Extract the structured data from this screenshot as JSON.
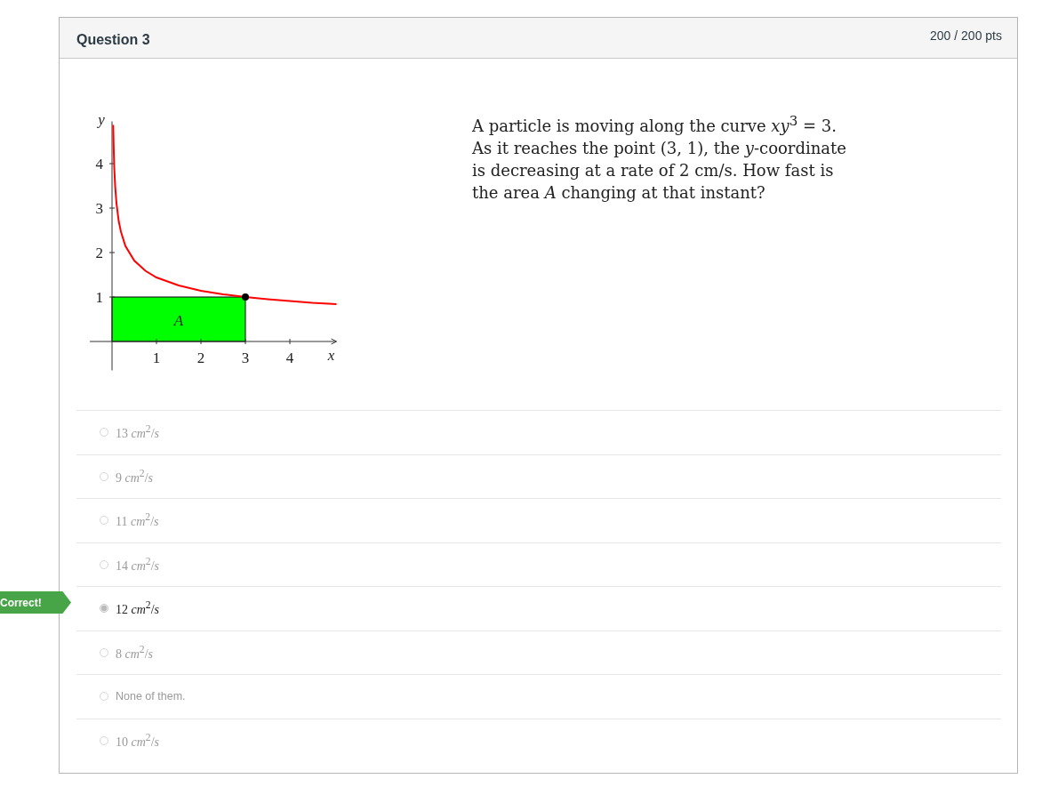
{
  "header": {
    "title": "Question 3",
    "score": "200 / 200 pts"
  },
  "figure": {
    "chart_data": {
      "type": "line",
      "xlabel": "x",
      "ylabel": "y",
      "xlim": [
        -0.5,
        5.05
      ],
      "ylim": [
        -0.65,
        4.95
      ],
      "xticks": [
        1,
        2,
        3,
        4
      ],
      "yticks": [
        1,
        2,
        3,
        4
      ],
      "x": [
        0.026,
        0.035,
        0.05,
        0.07,
        0.1,
        0.15,
        0.2,
        0.3,
        0.5,
        0.75,
        1,
        1.5,
        2,
        2.5,
        3,
        3.5,
        4,
        4.5,
        5.05
      ],
      "series": [
        {
          "color": "#ff0000",
          "values": [
            4.87,
            4.41,
            3.91,
            3.5,
            3.11,
            2.71,
            2.47,
            2.15,
            1.82,
            1.59,
            1.44,
            1.26,
            1.14,
            1.06,
            1,
            0.95,
            0.91,
            0.87,
            0.84
          ]
        }
      ],
      "annotations": [
        {
          "text": "A"
        }
      ]
    }
  },
  "question": "A particle is moving along the curve *xy*$^{3}$ = 3. As it reaches the point (3, 1), the *y*-coordinate is decreasing at a rate of 2 cm/s. How fast is the area *A* changing at that instant?",
  "options": [
    {
      "kind": "math",
      "label": "13 *cm*$^{2}$/*s*",
      "selected": false
    },
    {
      "kind": "math",
      "label": "9 *cm*$^{2}$/*s*",
      "selected": false
    },
    {
      "kind": "math",
      "label": "11 *cm*$^{2}$/*s*",
      "selected": false
    },
    {
      "kind": "math",
      "label": "14 *cm*$^{2}$/*s*",
      "selected": false
    },
    {
      "kind": "math",
      "label": "12 *cm*$^{2}$/*s*",
      "selected": true,
      "flag": "Correct!"
    },
    {
      "kind": "math",
      "label": "8 *cm*$^{2}$/*s*",
      "selected": false
    },
    {
      "kind": "text",
      "label": "None of them.",
      "selected": false
    },
    {
      "kind": "math",
      "label": "10 *cm*$^{2}$/*s*",
      "selected": false
    }
  ]
}
